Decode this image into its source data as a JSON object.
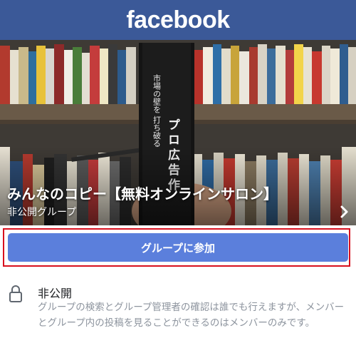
{
  "header": {
    "logo_text": "facebook",
    "bar_color": "#3b5998"
  },
  "cover": {
    "book_spine_text_top": "市場の壁を 打ち破る",
    "book_spine_title": "プロ広告作",
    "group_name": "みんなのコピー【無料オンラインサロン】",
    "privacy_label": "非公開グループ",
    "more_icon": "chevron-right-icon"
  },
  "join": {
    "label": "グループに参加",
    "button_color": "#5b7fdc",
    "highlight_color": "#d8101e"
  },
  "privacy": {
    "icon": "lock-icon",
    "heading": "非公開",
    "description": "グループの検索とグループ管理者の確認は誰でも行えますが、メンバーとグループ内の投稿を見ることができるのはメンバーのみです。"
  }
}
